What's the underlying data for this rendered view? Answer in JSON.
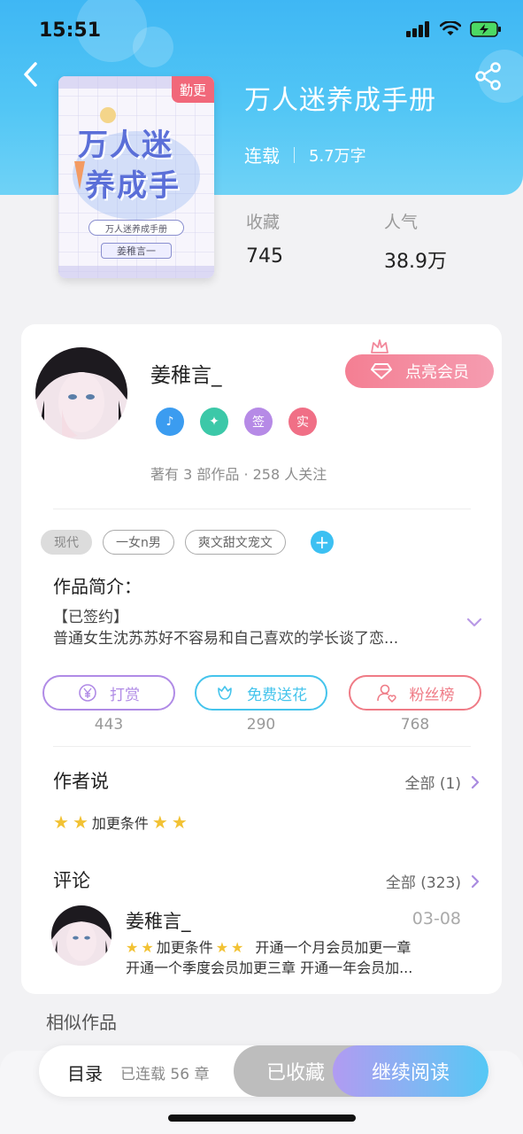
{
  "status_bar": {
    "time": "15:51"
  },
  "book": {
    "title": "万人迷养成手册",
    "cover_badge": "勤更",
    "cover_title_line1": "万人迷",
    "cover_title_line2": "养成手",
    "cover_subtitle": "万人迷养成手册",
    "cover_author": "姜稚言一",
    "status": "连载",
    "word_count": "5.7万字",
    "stats": [
      {
        "label": "收藏",
        "value": "745"
      },
      {
        "label": "人气",
        "value": "38.9万"
      }
    ]
  },
  "author": {
    "name": "姜稚言_",
    "vip_button": "点亮会员",
    "badges": [
      {
        "label": "",
        "color": "#3b9cf0",
        "icon": "music-medal-icon"
      },
      {
        "label": "",
        "color": "#3cc8a8",
        "icon": "handshake-medal-icon"
      },
      {
        "label": "签",
        "color": "#b68ae6",
        "icon": "signed-badge-icon"
      },
      {
        "label": "实",
        "color": "#f06f86",
        "icon": "verified-badge-icon"
      }
    ],
    "meta": "著有 3 部作品 · 258 人关注"
  },
  "tags": [
    "现代",
    "一女n男",
    "爽文甜文宠文"
  ],
  "intro": {
    "title": "作品简介：",
    "line1": "【已签约】",
    "line2": "普通女生沈苏苏好不容易和自己喜欢的学长谈了恋..."
  },
  "actions": [
    {
      "label": "打赏",
      "count": "443",
      "color": "#b08be6",
      "icon": "yen-icon"
    },
    {
      "label": "免费送花",
      "count": "290",
      "color": "#45c4ec",
      "icon": "flower-icon"
    },
    {
      "label": "粉丝榜",
      "count": "768",
      "color": "#ef7b86",
      "icon": "fan-user-icon"
    }
  ],
  "author_says": {
    "title": "作者说",
    "more": "全部 (1)",
    "content": "加更条件"
  },
  "comments": {
    "title": "评论",
    "more": "全部 (323)",
    "item": {
      "name": "姜稚言_",
      "date": "03-08",
      "line1_prefix": "加更条件",
      "line1_suffix": "开通一个月会员加更一章",
      "line2": "开通一个季度会员加更三章  开通一年会员加..."
    }
  },
  "similar": "相似作品",
  "bottom_bar": {
    "toc": "目录",
    "chapters": "已连载 56 章",
    "favorited": "已收藏",
    "continue": "继续阅读"
  },
  "colors": {
    "accent": "#3fb7f4",
    "vip": "#f47f93"
  }
}
